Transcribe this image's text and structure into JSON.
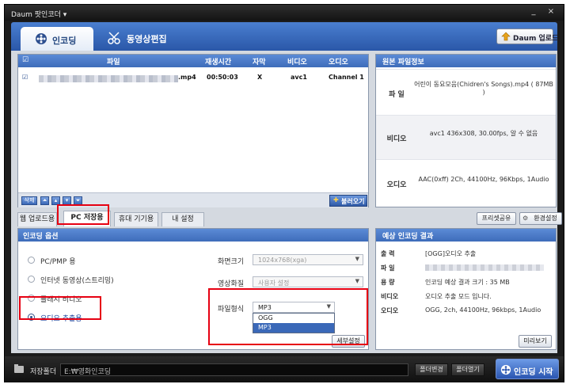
{
  "titlebar": {
    "title": "Daum 팟인코더 ▾",
    "minimize": "_",
    "close": "×"
  },
  "topbar": {
    "tab_encoding": "인코딩",
    "tab_edit": "동영상편집",
    "daum_upload": "Daum 업로드"
  },
  "filelist": {
    "headers": {
      "file": "파일",
      "duration": "재생시간",
      "subtitle": "자막",
      "video": "비디오",
      "audio": "오디오"
    },
    "row": {
      "ext": ".mp4",
      "duration": "00:50:03",
      "subtitle": "X",
      "video": "avc1",
      "audio": "Channel 1"
    },
    "footer": {
      "delete": "삭제",
      "load": "불러오기"
    }
  },
  "source_info": {
    "title": "원본 파일정보",
    "file_label": "파 일",
    "file_value": "어린이 동요모음(Chidren's Songs).mp4 ( 87MB )",
    "video_label": "비디오",
    "video_value": "avc1 436x308, 30.00fps, 알 수 없음",
    "audio_label": "오디오",
    "audio_value": "AAC(0xff) 2Ch, 44100Hz, 96Kbps, 1Audio"
  },
  "tabs": {
    "web_upload": "웹 업로드용",
    "pc_save": "PC 저장용",
    "mobile": "휴대 기기용",
    "my_settings": "내 설정",
    "preset_share": "프리셋공유",
    "env_settings": "환경설정"
  },
  "options": {
    "title": "인코딩 옵션",
    "radios": [
      "PC/PMP 용",
      "인터넷 동영상(스트리밍)",
      "플래시 비디오",
      "오디오 추출용"
    ],
    "screen_size_label": "화면크기",
    "screen_size_value": "1024x768(xga)",
    "quality_label": "영상화질",
    "quality_value": "사용자 설정",
    "format_label": "파일형식",
    "format_value": "MP3",
    "format_options": [
      "OGG",
      "MP3"
    ],
    "detail_button": "세부설정"
  },
  "result": {
    "title": "예상 인코딩 결과",
    "output_label": "출 력",
    "output_value": "[OGG]오디오 추출",
    "file_label": "파 일",
    "size_label": "용 량",
    "size_value": "인코딩 예상 결과 크기 : 35 MB",
    "video_label": "비디오",
    "video_value": "오디오 추출 모드 입니다.",
    "audio_label": "오디오",
    "audio_value": "OGG, 2ch, 44100Hz, 96kbps, 1Audio",
    "preview_button": "미리보기"
  },
  "bottombar": {
    "save_folder_label": "저장폴더",
    "path": "E:₩영화인코딩",
    "change_folder": "폴더변경",
    "open_folder": "폴더열기",
    "start_button": "인코딩 시작"
  }
}
